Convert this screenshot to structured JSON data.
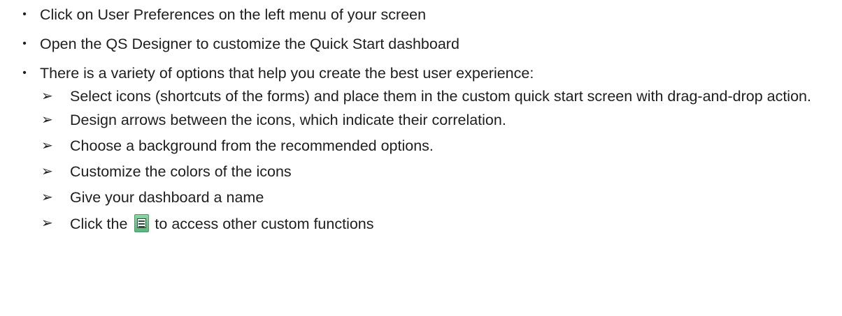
{
  "bullets": [
    "Click on User Preferences on the left menu of your screen",
    "Open the QS Designer to customize the Quick Start dashboard",
    "There is a variety of options that help you create the best user experience:"
  ],
  "sub_bullets": [
    "Select icons (shortcuts of the forms) and place them in the custom quick start screen with drag-and-drop action.",
    "Design arrows between the icons, which indicate their correlation.",
    "Choose a background from the recommended options.",
    "Customize the colors of the icons",
    "Give your dashboard a name"
  ],
  "last_sub_bullet": {
    "before": "Click the",
    "icon": "menu-icon",
    "after": "to access other custom functions"
  },
  "bullet_glyph": "•",
  "arrow_glyph": "➢",
  "colors": {
    "text": "#1e1e1e",
    "icon_fill": "#5fb37d"
  }
}
